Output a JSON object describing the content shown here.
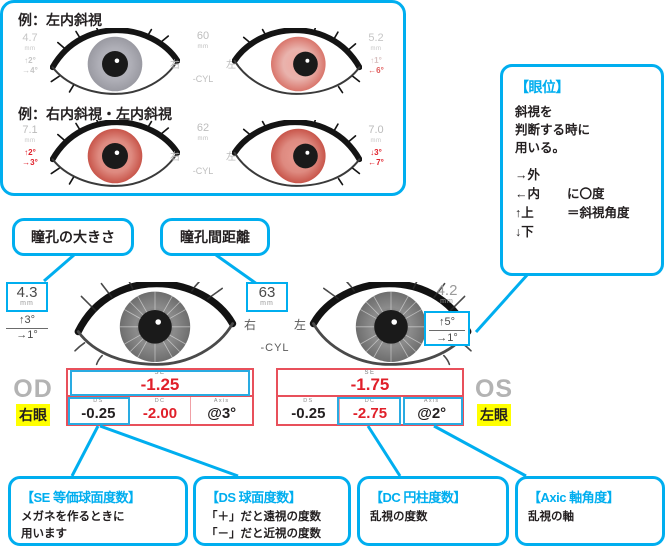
{
  "example_panel": {
    "rows": [
      {
        "title": "例：左内斜視",
        "left": {
          "value": "4.7",
          "unit": "mm",
          "ang1": "↑2°",
          "ang2": "→4°",
          "ang_color": "#b9b9b9"
        },
        "center": {
          "pd": "60",
          "unit": "mm",
          "right_label": "右",
          "left_label": "左",
          "cyl": "-CYL"
        },
        "right": {
          "value": "5.2",
          "unit": "mm",
          "ang1": "↑1°",
          "ang2": "←6°",
          "ang_color": "#e05a5a"
        }
      },
      {
        "title": "例：右内斜視・左内斜視",
        "left": {
          "value": "7.1",
          "unit": "mm",
          "ang1": "↑2°",
          "ang2": "→3°",
          "ang_color": "#e0202a"
        },
        "center": {
          "pd": "62",
          "unit": "mm",
          "right_label": "右",
          "left_label": "左",
          "cyl": "-CYL"
        },
        "right": {
          "value": "7.0",
          "unit": "mm",
          "ang1": "↓3°",
          "ang2": "←7°",
          "ang_color": "#e0202a"
        }
      }
    ]
  },
  "eye_position_callout": {
    "title": "【眼位】",
    "lines": [
      "斜視を",
      "判断する時に",
      "用いる。"
    ],
    "legend": [
      {
        "arrow": "→外",
        "note": ""
      },
      {
        "arrow": "←内",
        "note": "に〇度"
      },
      {
        "arrow": "↑上",
        "note": "＝斜視角度"
      },
      {
        "arrow": "↓下",
        "note": ""
      }
    ]
  },
  "callouts": {
    "pupil_size": "瞳孔の大きさ",
    "pupil_distance": "瞳孔間距離"
  },
  "measurements": {
    "od": {
      "pupil": "4.3",
      "unit": "mm",
      "ang_up": "↑3°",
      "ang_side": "→1°"
    },
    "pd": {
      "value": "63",
      "unit": "mm"
    },
    "os": {
      "pupil": "4.2",
      "unit": "mm",
      "ang_up": "↑5°",
      "ang_side": "→1°"
    },
    "right_label": "右",
    "left_label": "左",
    "cyl": "-CYL"
  },
  "prescription": {
    "od": {
      "se_label": "SE",
      "se_value": "-1.25",
      "cells": [
        {
          "label": "DS",
          "value": "-0.25",
          "red": false
        },
        {
          "label": "DC",
          "value": "-2.00",
          "red": true
        },
        {
          "label": "Axis",
          "value": "@3°",
          "red": false
        }
      ]
    },
    "os": {
      "se_label": "SE",
      "se_value": "-1.75",
      "cells": [
        {
          "label": "DS",
          "value": "-0.25",
          "red": false
        },
        {
          "label": "DC",
          "value": "-2.75",
          "red": true
        },
        {
          "label": "Axis",
          "value": "@2°",
          "red": false
        }
      ]
    }
  },
  "eye_labels": {
    "od_en": "OD",
    "od_jp": "右眼",
    "os_en": "OS",
    "os_jp": "左眼"
  },
  "legend_boxes": [
    {
      "title": "【SE 等価球面度数】",
      "lines": [
        "メガネを作るときに",
        "用います"
      ]
    },
    {
      "title": "【DS 球面度数】",
      "lines": [
        "「＋」だと遠視の度数",
        "「－」だと近視の度数"
      ]
    },
    {
      "title": "【DC 円柱度数】",
      "lines": [
        "乱視の度数"
      ]
    },
    {
      "title": "【Axic 軸角度】",
      "lines": [
        "乱視の軸"
      ]
    }
  ],
  "colors": {
    "accent_blue": "#00aeef",
    "red": "#e0202a",
    "highlight": "#ffff00",
    "gray": "#b3b3b3"
  }
}
